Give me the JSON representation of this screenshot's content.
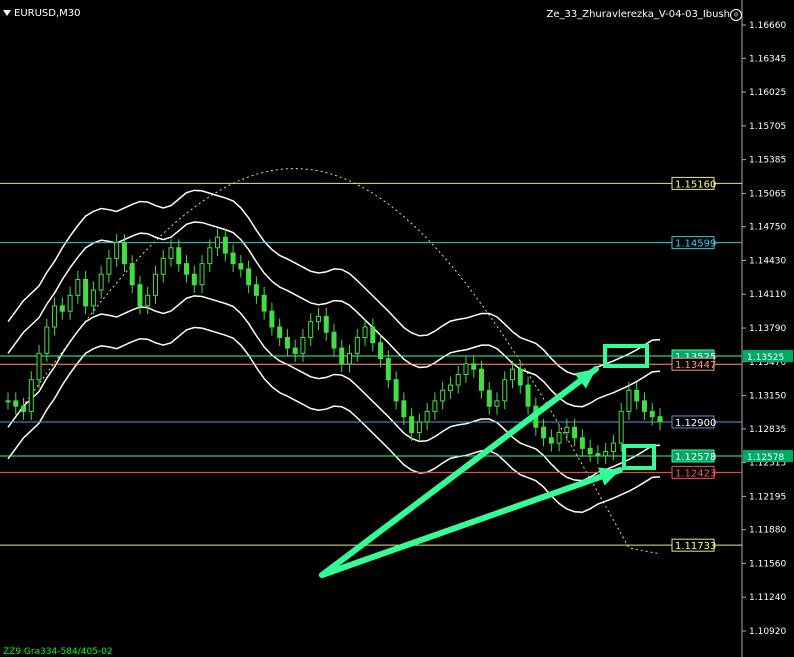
{
  "header": {
    "symbol": "EURUSD,M30",
    "expert": "Ze_33_Zhuravlerezka_V-04-03_Ibush"
  },
  "footer": {
    "text": "ZZ9 Gra334-584/405-02"
  },
  "chart_data": {
    "type": "candlestick",
    "price_axis": {
      "ticks": [
        "1.16660",
        "1.16345",
        "1.16025",
        "1.15705",
        "1.15385",
        "1.15065",
        "1.14750",
        "1.14430",
        "1.14110",
        "1.13790",
        "1.13470",
        "1.13150",
        "1.12835",
        "1.12515",
        "1.12195",
        "1.11880",
        "1.11560",
        "1.11240",
        "1.10920"
      ],
      "range": [
        1.1074,
        1.1685
      ]
    },
    "levels": [
      {
        "label": "1.15160",
        "price": 1.1516,
        "color": "#e8e88a",
        "style": "solid",
        "label_color": "#ffff66"
      },
      {
        "label": "1.14599",
        "price": 1.14599,
        "color": "#33cccc",
        "style": "solid",
        "label_color": "#33ccff"
      },
      {
        "label": "1.13525",
        "price": 1.13525,
        "color": "#33ff99",
        "style": "solid",
        "label_color": "#ffffff",
        "label_bg": "#00aa66"
      },
      {
        "label": "1.13447",
        "price": 1.13447,
        "color": "#ff9966",
        "style": "solid",
        "label_color": "#ff9966"
      },
      {
        "label": "1.12900",
        "price": 1.129,
        "color": "#5599dd",
        "style": "solid",
        "label_color": "#ffffff",
        "label_bg": "#000000"
      },
      {
        "label": "1.12578",
        "price": 1.12578,
        "color": "#33ff99",
        "style": "solid",
        "label_color": "#ffffff",
        "label_bg": "#00aa66"
      },
      {
        "label": "1.12423",
        "price": 1.12423,
        "color": "#ff5555",
        "style": "solid",
        "label_color": "#ff5555"
      },
      {
        "label": "1.11733",
        "price": 1.11733,
        "color": "#e8e88a",
        "style": "solid",
        "label_color": "#ffff66"
      }
    ],
    "close_series": [
      1.131,
      1.1305,
      1.13,
      1.133,
      1.1355,
      1.138,
      1.14,
      1.1395,
      1.141,
      1.1425,
      1.14,
      1.1415,
      1.143,
      1.1445,
      1.146,
      1.144,
      1.142,
      1.14,
      1.141,
      1.143,
      1.1445,
      1.1455,
      1.144,
      1.143,
      1.142,
      1.144,
      1.1455,
      1.1465,
      1.145,
      1.144,
      1.1435,
      1.142,
      1.141,
      1.1395,
      1.138,
      1.137,
      1.136,
      1.1355,
      1.137,
      1.1385,
      1.139,
      1.1375,
      1.136,
      1.1345,
      1.1355,
      1.137,
      1.138,
      1.1365,
      1.135,
      1.133,
      1.131,
      1.1295,
      1.128,
      1.129,
      1.13,
      1.131,
      1.132,
      1.1325,
      1.1335,
      1.1345,
      1.134,
      1.132,
      1.1305,
      1.131,
      1.133,
      1.134,
      1.1325,
      1.1305,
      1.1285,
      1.1275,
      1.127,
      1.128,
      1.1285,
      1.1275,
      1.1265,
      1.126,
      1.1258,
      1.1262,
      1.127,
      1.13,
      1.132,
      1.131,
      1.13,
      1.1295,
      1.129
    ],
    "indicators": {
      "upper_band_color": "#ffffff",
      "lower_band_color": "#ffffff",
      "ma_color": "#e8e84a",
      "candle_color": "#44dd44"
    },
    "annotations": [
      {
        "type": "arrow",
        "color": "#33ff99"
      },
      {
        "type": "arrow",
        "color": "#33ff99"
      },
      {
        "type": "box",
        "color": "#33ff99"
      },
      {
        "type": "box",
        "color": "#33ff99"
      }
    ]
  }
}
